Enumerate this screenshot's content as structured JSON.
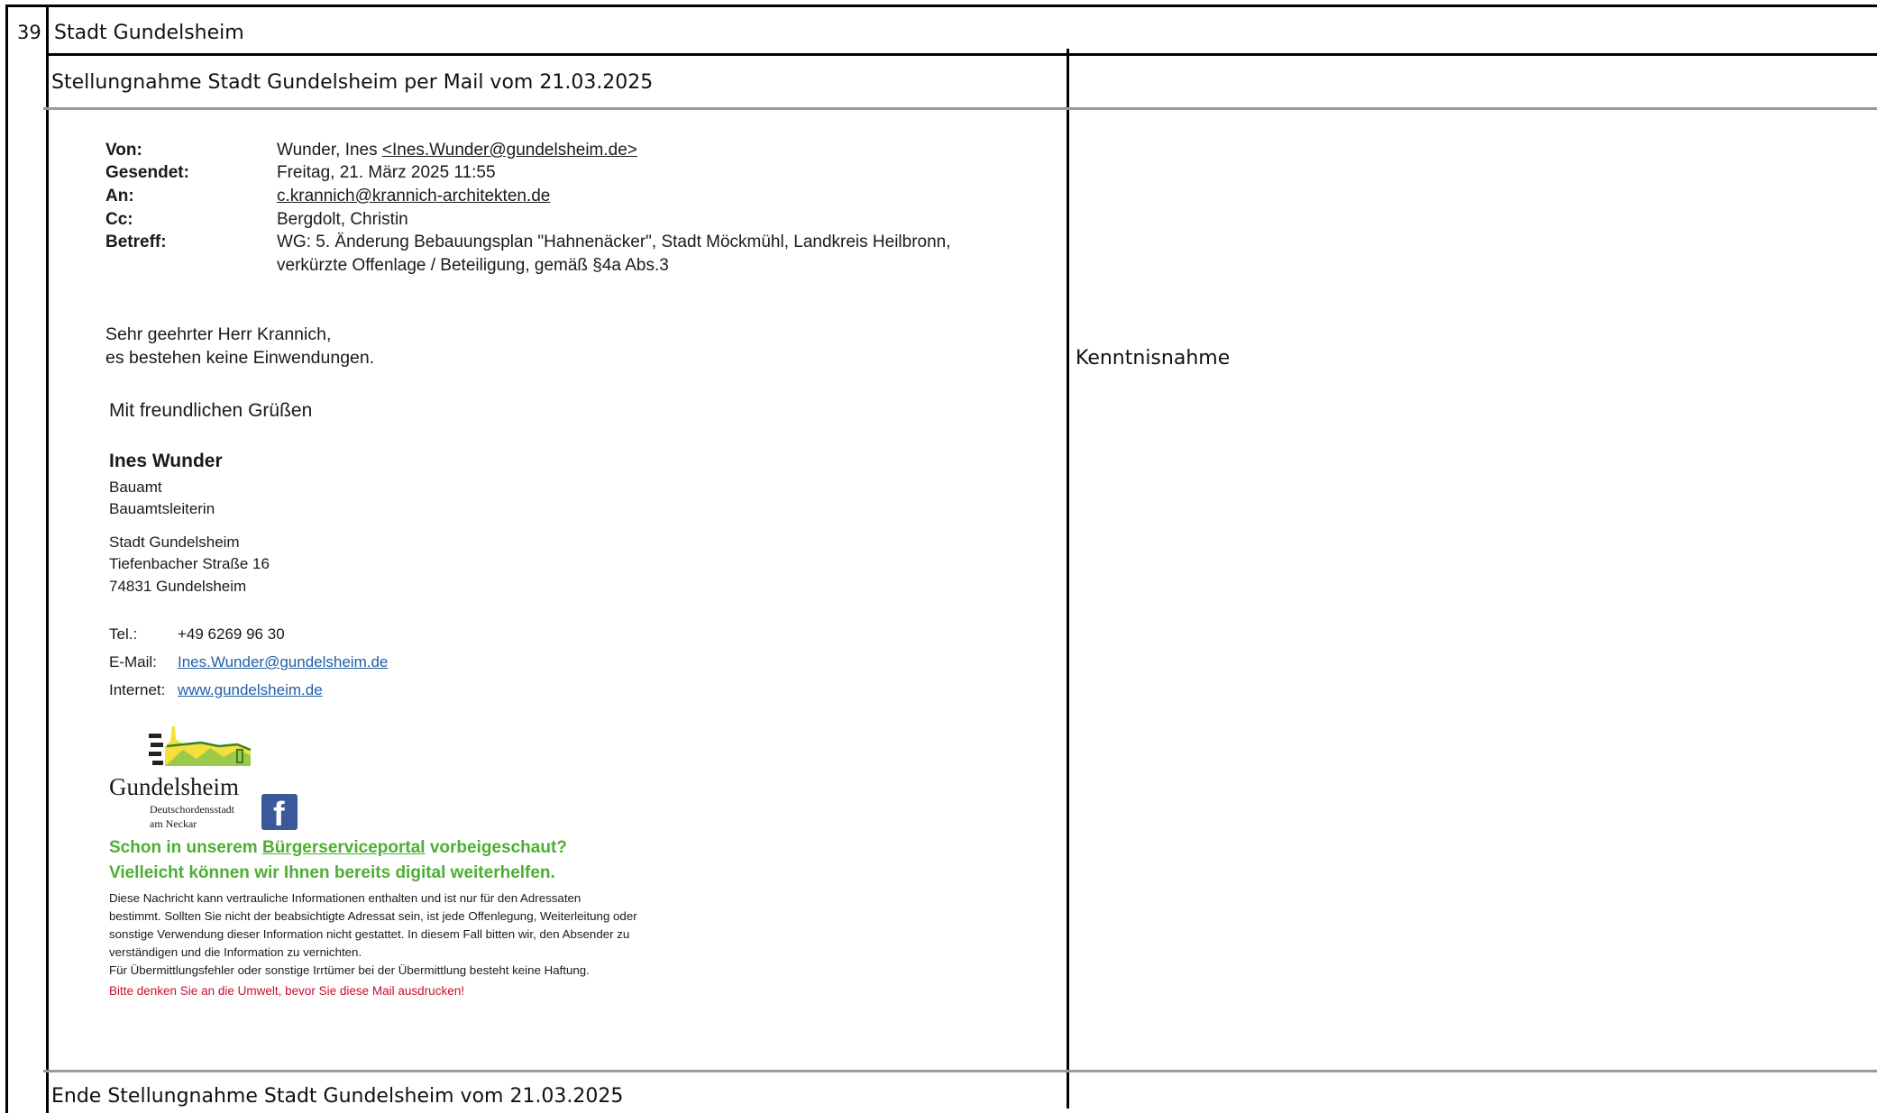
{
  "row": {
    "index": "39",
    "organization": "Stadt Gundelsheim"
  },
  "statement": {
    "header": "Stellungnahme Stadt Gundelsheim per Mail vom 21.03.2025",
    "response": "Kenntnisnahme",
    "footer": "Ende Stellungnahme Stadt Gundelsheim vom 21.03.2025"
  },
  "email": {
    "fields": {
      "from_label": "Von:",
      "from_value": "Wunder, Ines",
      "from_email": "<Ines.Wunder@gundelsheim.de>",
      "sent_label": "Gesendet:",
      "sent_value": "Freitag, 21. März 2025 11:55",
      "to_label": "An:",
      "to_value": "c.krannich@krannich-architekten.de",
      "cc_label": "Cc:",
      "cc_value": "Bergdolt, Christin",
      "subject_label": "Betreff:",
      "subject_line1": "WG: 5. Änderung Bebauungsplan \"Hahnenäcker\", Stadt Möckmühl, Landkreis Heilbronn,",
      "subject_line2": "verkürzte Offenlage / Beteiligung, gemäß §4a Abs.3"
    },
    "body": {
      "greeting": "Sehr geehrter Herr Krannich,",
      "text": "es bestehen keine Einwendungen.",
      "closing": "Mit freundlichen Grüßen"
    },
    "signature": {
      "name": "Ines Wunder",
      "department": "Bauamt",
      "role": "Bauamtsleiterin",
      "org": "Stadt Gundelsheim",
      "street": "Tiefenbacher Straße 16",
      "city": "74831 Gundelsheim",
      "tel_label": "Tel.:",
      "tel": "+49 6269 96 30",
      "email_label": "E-Mail:",
      "email": "Ines.Wunder@gundelsheim.de",
      "web_label": "Internet:",
      "web": "www.gundelsheim.de"
    },
    "logo": {
      "name": "Gundelsheim",
      "sub1": "Deutschordensstadt",
      "sub2": "am Neckar"
    },
    "promo": {
      "line1_pre": "Schon in unserem ",
      "line1_link": "Bürgerserviceportal",
      "line1_post": " vorbeigeschaut?",
      "line2": "Vielleicht können wir Ihnen bereits digital weiterhelfen."
    },
    "disclaimer": [
      "Diese Nachricht kann vertrauliche Informationen enthalten und ist nur für den Adressaten",
      "bestimmt. Sollten Sie nicht der beabsichtigte Adressat sein, ist jede Offenlegung, Weiterleitung oder",
      "sonstige Verwendung dieser Information nicht gestattet. In diesem Fall bitten wir, den Absender zu",
      "verständigen und die Information zu vernichten.",
      "Für Übermittlungsfehler oder sonstige Irrtümer bei der Übermittlung besteht keine Haftung."
    ],
    "eco_note": "Bitte denken Sie an die Umwelt, bevor Sie diese Mail ausdrucken!"
  },
  "colors": {
    "border": "#000000",
    "divider": "#9a9a9a",
    "link": "#1f5fa8",
    "promo": "#4caf32",
    "eco": "#c8102e",
    "facebook": "#3b5998"
  }
}
